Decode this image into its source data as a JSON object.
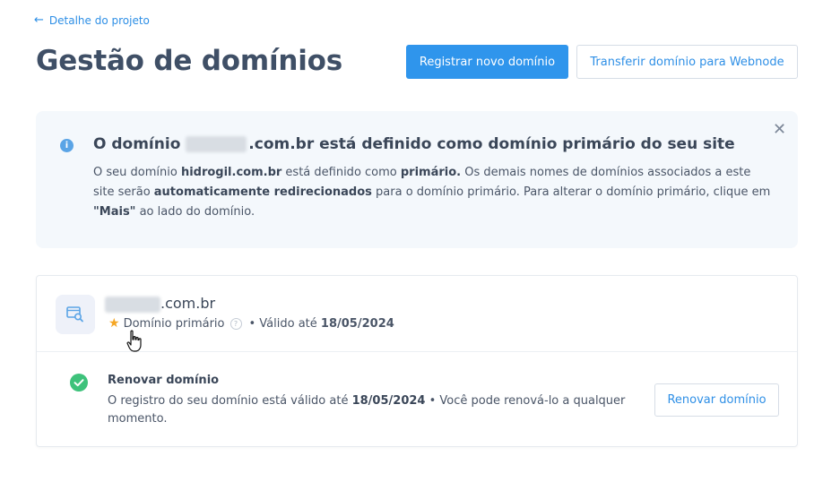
{
  "header": {
    "back_label": "Detalhe do projeto",
    "title": "Gestão de domínios",
    "register_button": "Registrar novo domínio",
    "transfer_button": "Transferir domínio para Webnode"
  },
  "info_box": {
    "title_prefix": "O domínio",
    "title_suffix": ".com.br está definido como domínio primário do seu site",
    "text_1": "O seu domínio ",
    "text_domain": "hidrogil.com.br",
    "text_2": " está definido como ",
    "text_primary": "primário.",
    "text_3": " Os demais nomes de domínios associados a este site serão ",
    "text_redirect": "automaticamente redirecionados",
    "text_4": " para o domínio primário. Para alterar o domínio primário, clique em ",
    "text_mais": "\"Mais\"",
    "text_5": " ao lado do domínio."
  },
  "domain_card": {
    "domain_suffix": ".com.br",
    "primary_label": "Domínio primário",
    "valid_prefix": "• Válido até",
    "valid_date": "18/05/2024",
    "renew_title": "Renovar domínio",
    "renew_text_1": "O registro do seu domínio está válido até ",
    "renew_date": "18/05/2024",
    "renew_text_2": " • Você pode renová-lo a qualquer momento.",
    "renew_button": "Renovar domínio"
  },
  "colors": {
    "accent": "#2f95ec",
    "success": "#3ec27b",
    "star": "#f5a623",
    "info_bg": "#f4f8fc"
  }
}
